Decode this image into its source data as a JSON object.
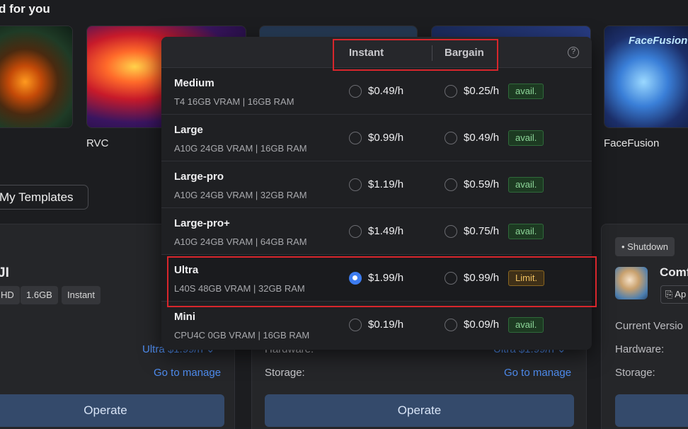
{
  "section_title": "d for you",
  "thumbnails": [
    {
      "label": ""
    },
    {
      "label": "RVC"
    },
    {
      "label": ""
    },
    {
      "label": ""
    },
    {
      "label": "FaceFusion",
      "overlay_text": "FaceFusion"
    }
  ],
  "my_templates_label": "My Templates",
  "card1": {
    "title": "JI",
    "tags": [
      "HD",
      "1.6GB",
      "Instant"
    ],
    "hardware_value": "Ultra  $1.99/h  ⌄",
    "manage_label": "Go to manage",
    "operate_label": "Operate"
  },
  "card2": {
    "hardware_label": "Hardware:",
    "storage_label": "Storage:",
    "hardware_value": "Ultra  $1.99/h  ⌄",
    "manage_label": "Go to manage",
    "operate_label": "Operate"
  },
  "card3": {
    "status": "• Shutdown",
    "title": "Comf",
    "action_label": "⎘ Ap",
    "current_version_label": "Current Versio",
    "hardware_label": "Hardware:",
    "storage_label": "Storage:"
  },
  "dropdown": {
    "header": {
      "instant": "Instant",
      "bargain": "Bargain",
      "help_icon": "?"
    },
    "rows": [
      {
        "name": "Medium",
        "spec": "T4 16GB VRAM | 16GB RAM",
        "instant": "$0.49/h",
        "bargain": "$0.25/h",
        "status": "avail.",
        "selected": false
      },
      {
        "name": "Large",
        "spec": "A10G 24GB VRAM | 16GB RAM",
        "instant": "$0.99/h",
        "bargain": "$0.49/h",
        "status": "avail.",
        "selected": false
      },
      {
        "name": "Large-pro",
        "spec": "A10G 24GB VRAM | 32GB RAM",
        "instant": "$1.19/h",
        "bargain": "$0.59/h",
        "status": "avail.",
        "selected": false
      },
      {
        "name": "Large-pro+",
        "spec": "A10G 24GB VRAM | 64GB RAM",
        "instant": "$1.49/h",
        "bargain": "$0.75/h",
        "status": "avail.",
        "selected": false
      },
      {
        "name": "Ultra",
        "spec": "L40S 48GB VRAM | 32GB RAM",
        "instant": "$1.99/h",
        "bargain": "$0.99/h",
        "status": "Limit.",
        "selected": true
      },
      {
        "name": "Mini",
        "spec": "CPU4C 0GB VRAM | 16GB RAM",
        "instant": "$0.19/h",
        "bargain": "$0.09/h",
        "status": "avail.",
        "selected": false
      }
    ]
  },
  "colors": {
    "accent": "#3d7cf0",
    "link": "#4f8df0",
    "highlight": "#d8262c",
    "avail": "#8ed89a",
    "limit": "#f0c060"
  }
}
